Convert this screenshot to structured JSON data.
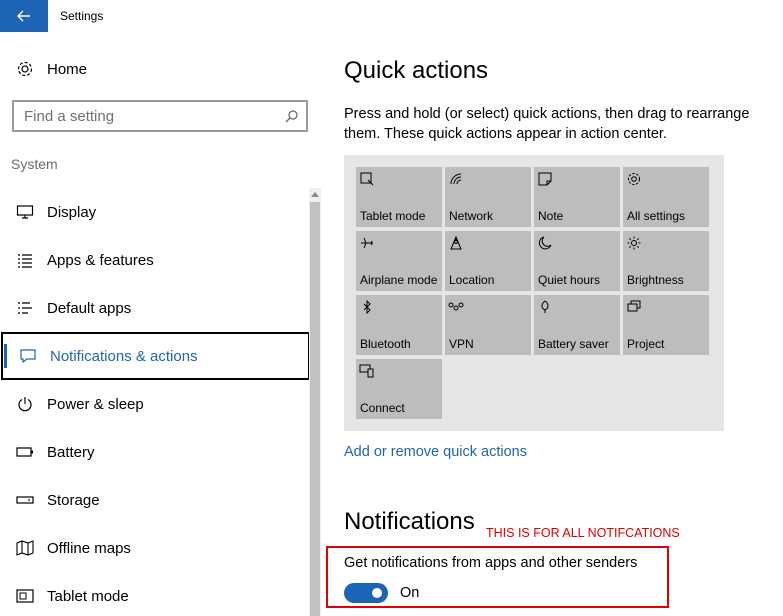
{
  "window": {
    "title": "Settings",
    "back_icon": "back-arrow-icon",
    "accent": "#1e64b4"
  },
  "sidebar": {
    "home_label": "Home",
    "search_placeholder": "Find a setting",
    "group_label": "System",
    "items": [
      {
        "label": "Display",
        "icon": "display-icon",
        "selected": false
      },
      {
        "label": "Apps & features",
        "icon": "apps-list-icon",
        "selected": false
      },
      {
        "label": "Default apps",
        "icon": "default-apps-icon",
        "selected": false
      },
      {
        "label": "Notifications & actions",
        "icon": "notification-icon",
        "selected": true
      },
      {
        "label": "Power & sleep",
        "icon": "power-icon",
        "selected": false
      },
      {
        "label": "Battery",
        "icon": "battery-icon",
        "selected": false
      },
      {
        "label": "Storage",
        "icon": "storage-icon",
        "selected": false
      },
      {
        "label": "Offline maps",
        "icon": "map-icon",
        "selected": false
      },
      {
        "label": "Tablet mode",
        "icon": "tablet-icon",
        "selected": false
      }
    ]
  },
  "main": {
    "quick_actions_title": "Quick actions",
    "quick_actions_desc": "Press and hold (or select) quick actions, then drag to rearrange them. These quick actions appear in action center.",
    "tiles": [
      {
        "label": "Tablet mode",
        "icon": "tablet-mode-icon"
      },
      {
        "label": "Network",
        "icon": "network-icon"
      },
      {
        "label": "Note",
        "icon": "note-icon"
      },
      {
        "label": "All settings",
        "icon": "gear-icon"
      },
      {
        "label": "Airplane mode",
        "icon": "airplane-icon"
      },
      {
        "label": "Location",
        "icon": "location-icon"
      },
      {
        "label": "Quiet hours",
        "icon": "moon-icon"
      },
      {
        "label": "Brightness",
        "icon": "brightness-icon"
      },
      {
        "label": "Bluetooth",
        "icon": "bluetooth-icon"
      },
      {
        "label": "VPN",
        "icon": "vpn-icon"
      },
      {
        "label": "Battery saver",
        "icon": "battery-saver-icon"
      },
      {
        "label": "Project",
        "icon": "project-icon"
      },
      {
        "label": "Connect",
        "icon": "connect-icon"
      }
    ],
    "add_remove_link": "Add or remove quick actions",
    "notifications_title": "Notifications",
    "annotation": "THIS IS FOR ALL NOTIFCATIONS",
    "get_notifications_label": "Get notifications from apps and other senders",
    "toggle_state": "On"
  }
}
